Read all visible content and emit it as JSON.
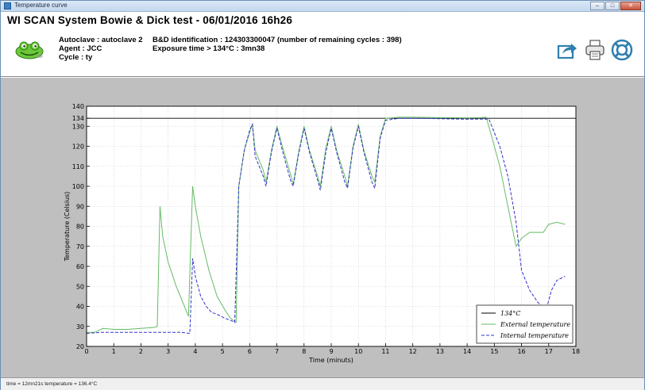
{
  "window": {
    "title": "Temperature curve"
  },
  "header": {
    "main_title": "WI SCAN System Bowie & Dick test - 06/01/2016  16h26",
    "autoclave": "Autoclave : autoclave 2",
    "agent": "Agent : JCC",
    "cycle": "Cycle : ty",
    "identification": "B&D identification : 124303300047 (number of remaining cycles : 398)",
    "exposure": "Exposure time > 134°C : 3mn38"
  },
  "toolbar": {
    "icons": [
      "export-icon",
      "printer-icon",
      "help-icon"
    ]
  },
  "status": {
    "text": "time = 12mn21s  temperature = 136.4°C"
  },
  "colors": {
    "external": "#66bb66",
    "internal": "#3333cc",
    "reference": "#000000",
    "background": "#bfbfbf"
  },
  "chart_data": {
    "type": "line",
    "xlabel": "Time (minuts)",
    "ylabel": "Temperature (Celsius)",
    "xlim": [
      0,
      18
    ],
    "ylim": [
      20,
      140
    ],
    "x_ticks": [
      0,
      1,
      2,
      3,
      4,
      5,
      6,
      7,
      8,
      9,
      10,
      11,
      12,
      13,
      14,
      15,
      16,
      17,
      18
    ],
    "y_ticks": [
      20,
      30,
      40,
      50,
      60,
      70,
      80,
      90,
      100,
      110,
      120,
      130,
      134,
      140
    ],
    "grid": true,
    "legend_position": "bottom-right",
    "series": [
      {
        "name": "134°C",
        "style": "solid",
        "color": "#000000",
        "x": [
          0,
          18
        ],
        "y": [
          134,
          134
        ]
      },
      {
        "name": "External temperature",
        "style": "solid",
        "color": "#66bb66",
        "x": [
          0,
          0.3,
          0.6,
          1,
          1.5,
          2,
          2.5,
          2.6,
          2.7,
          2.8,
          3.0,
          3.3,
          3.6,
          3.75,
          3.9,
          4.0,
          4.2,
          4.5,
          4.8,
          5.1,
          5.3,
          5.5,
          5.6,
          5.8,
          6.0,
          6.1,
          6.2,
          6.5,
          6.6,
          6.8,
          7.0,
          7.2,
          7.5,
          7.6,
          7.8,
          8.0,
          8.2,
          8.5,
          8.6,
          8.8,
          9.0,
          9.2,
          9.5,
          9.6,
          9.8,
          10.0,
          10.2,
          10.5,
          10.6,
          10.8,
          11.0,
          11.5,
          12.0,
          13.0,
          14.0,
          14.5,
          14.7,
          14.9,
          15.2,
          15.5,
          15.8,
          16.0,
          16.3,
          16.6,
          16.8,
          17.0,
          17.3,
          17.6
        ],
        "y": [
          27,
          27,
          29,
          28.5,
          28.5,
          29,
          29.5,
          30,
          90,
          75,
          62,
          50,
          40,
          35,
          100,
          90,
          75,
          58,
          45,
          38,
          34,
          32,
          100,
          118,
          127,
          131,
          118,
          108,
          102,
          118,
          130,
          120,
          106,
          101,
          117,
          130,
          118,
          105,
          100,
          119,
          130,
          118,
          105,
          100,
          120,
          131,
          118,
          105,
          102,
          125,
          134,
          134.5,
          134.5,
          134.3,
          134.2,
          134.3,
          134.5,
          125,
          110,
          90,
          70,
          74,
          77,
          77,
          77,
          81,
          82,
          81
        ]
      },
      {
        "name": "Internal temperature",
        "style": "dashed",
        "color": "#3333cc",
        "x": [
          0,
          0.5,
          1,
          1.5,
          2,
          2.5,
          3,
          3.5,
          3.8,
          3.9,
          4.0,
          4.2,
          4.4,
          4.6,
          4.8,
          5.1,
          5.3,
          5.45,
          5.6,
          5.8,
          6.0,
          6.1,
          6.2,
          6.5,
          6.6,
          6.8,
          7.0,
          7.2,
          7.5,
          7.6,
          7.8,
          8.0,
          8.2,
          8.5,
          8.6,
          8.8,
          9.0,
          9.2,
          9.5,
          9.6,
          9.8,
          10.0,
          10.2,
          10.5,
          10.6,
          10.8,
          11.0,
          11.5,
          12.0,
          13.0,
          14.0,
          14.5,
          14.8,
          15.2,
          15.5,
          15.8,
          16.0,
          16.3,
          16.6,
          16.9,
          17.1,
          17.3,
          17.6
        ],
        "y": [
          26.5,
          27,
          27,
          27,
          27,
          27,
          27,
          27,
          26.5,
          64,
          55,
          45,
          40,
          37,
          36,
          34,
          33,
          32,
          100,
          118,
          128,
          131,
          115,
          105,
          100,
          117,
          129,
          118,
          103,
          100,
          116,
          129,
          117,
          103,
          98,
          117,
          129,
          117,
          102,
          99,
          119,
          130,
          117,
          102,
          99,
          124,
          133,
          134,
          134,
          133.8,
          133.5,
          133.6,
          133.6,
          120,
          105,
          82,
          58,
          48,
          42,
          38,
          48,
          53,
          55
        ]
      }
    ]
  }
}
